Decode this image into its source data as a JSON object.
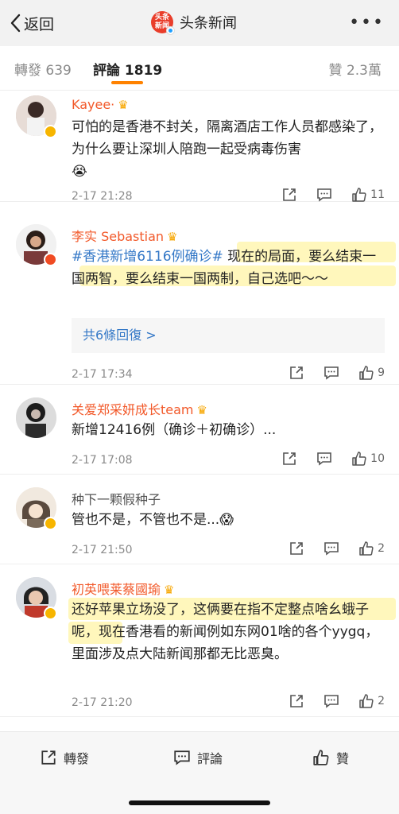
{
  "header": {
    "back_label": "返回",
    "logo_line1": "头条",
    "logo_line2": "新闻",
    "title": "头条新闻",
    "more_label": "•••"
  },
  "tabs": {
    "repost": "轉發 639",
    "comment": "評論 1819",
    "like": "贊 2.3萬"
  },
  "comments": [
    {
      "name": "Kayee·",
      "badge": "yellow",
      "text": "可怕的是香港不封关，隔离酒店工作人员都感染了，为什么要让深圳人陪跑一起受病毒伤害",
      "emoji": "😭",
      "time": "2-17 21:28",
      "likes": "11"
    },
    {
      "name": "李实 Sebastian",
      "badge": "red",
      "hashtag": "#香港新增6116例确诊#",
      "text": " 现在的局面，要么结束一国两智，要么结束一国两制，自己选吧～～",
      "replies_label": "共6條回復 >",
      "time": "2-17 17:34",
      "likes": "9"
    },
    {
      "name": "关爱郑采妍成长team",
      "badge": "none",
      "text": "新增12416例（确诊＋初确诊）...",
      "time": "2-17 17:08",
      "likes": "10"
    },
    {
      "name": "种下一颗假种子",
      "badge": "yellow",
      "text": "管也不是，不管也不是...",
      "emoji": "😱",
      "time": "2-17 21:50",
      "likes": "2"
    },
    {
      "name": "初英喂莱蔡國瑜",
      "badge": "yellow",
      "text": "还好苹果立场没了，这俩要在指不定整点啥幺蛾子呢，现在香港看的新闻例如东网01啥的各个yygq，里面涉及点大陆新闻那都无比恶臭。",
      "time": "2-17 21:20",
      "likes": "2"
    }
  ],
  "bottom_bar": {
    "repost": "轉發",
    "comment": "評論",
    "like": "贊"
  },
  "colors": {
    "accent": "#ff8200",
    "name": "#f2592a",
    "link": "#3478c7",
    "highlight": "#fff6b0"
  }
}
